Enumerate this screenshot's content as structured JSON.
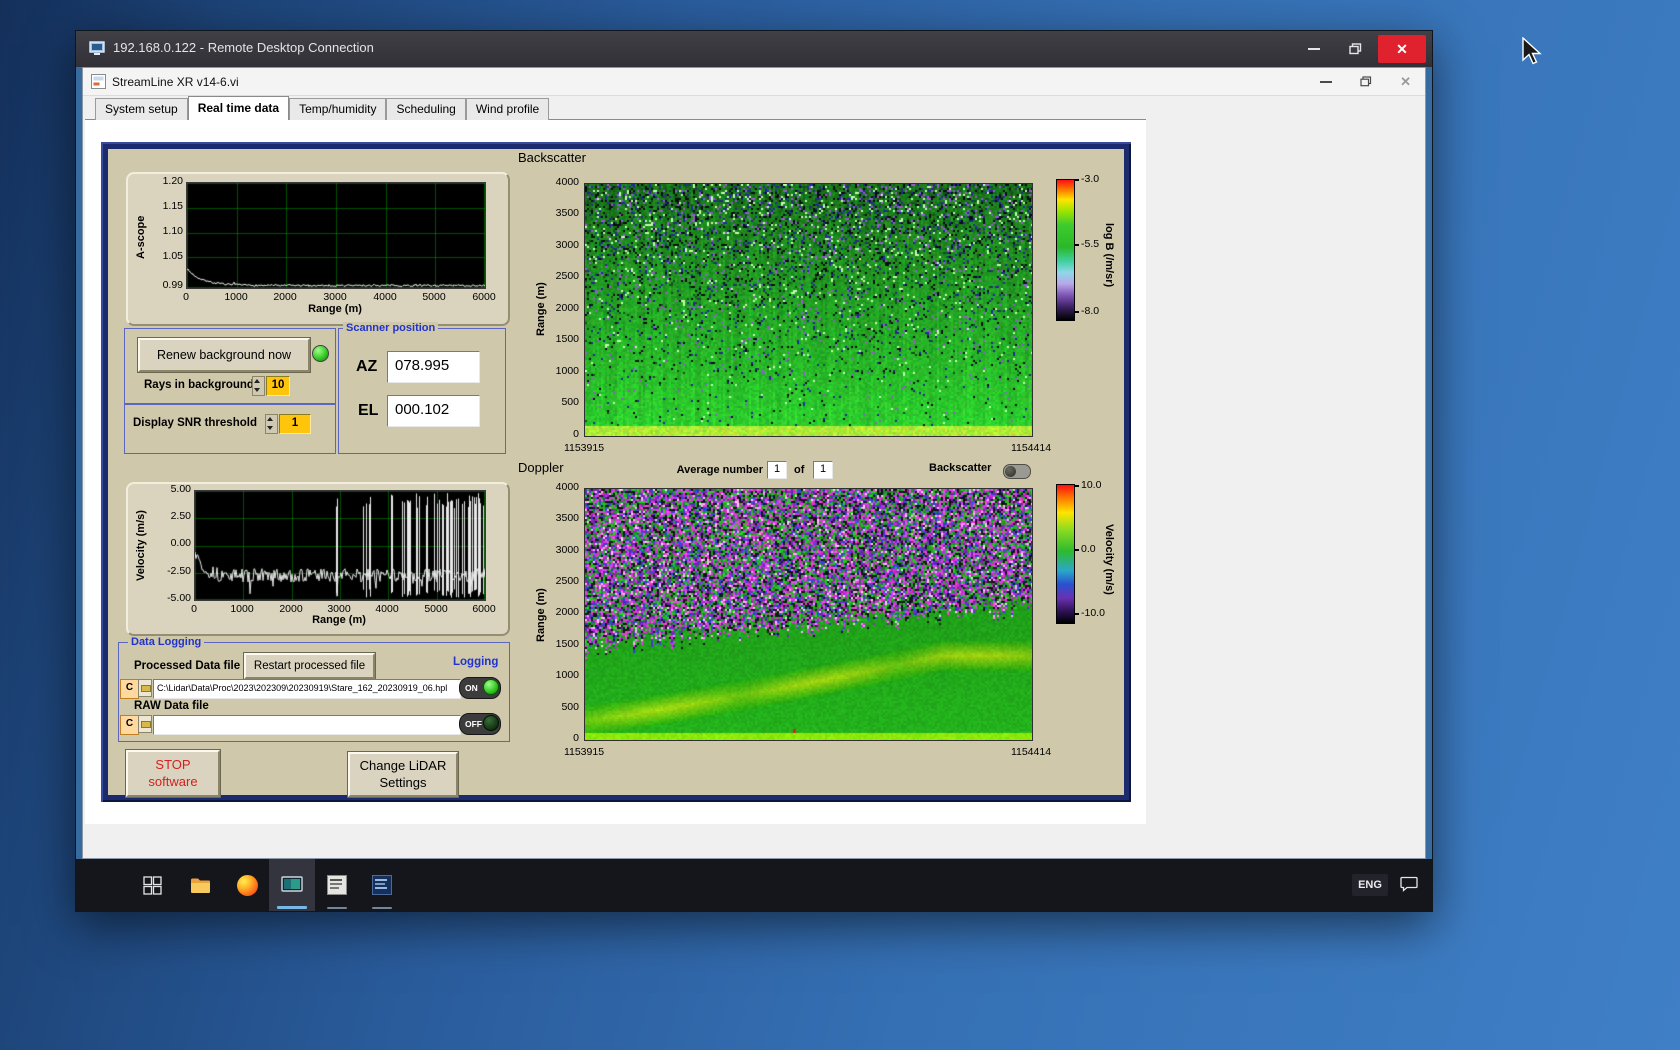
{
  "colors": {
    "panel_navy": "#1c2a6e",
    "panel_tan": "#cfc8ab",
    "field_orange": "#ffc40c",
    "led_green": "#2fc41e",
    "close_red": "#e0222e",
    "group_title_blue": "#2233cc"
  },
  "rdp": {
    "title": "192.168.0.122 - Remote Desktop Connection"
  },
  "app": {
    "title": "StreamLine XR v14-6.vi",
    "tabs": [
      "System setup",
      "Real time data",
      "Temp/humidity",
      "Scheduling",
      "Wind profile"
    ],
    "active_tab": "Real time data"
  },
  "ascope": {
    "ylabel": "A-scope",
    "xlabel": "Range (m)",
    "yticks": [
      "1.20",
      "1.15",
      "1.10",
      "1.05",
      "0.99"
    ],
    "xticks": [
      "0",
      "1000",
      "2000",
      "3000",
      "4000",
      "5000",
      "6000"
    ]
  },
  "background_ctrl": {
    "renew_button": "Renew background now",
    "rays_label": "Rays in background",
    "rays_value": "10",
    "snr_label": "Display SNR threshold",
    "snr_value": "1"
  },
  "scanner": {
    "title": "Scanner position",
    "az_label": "AZ",
    "az_value": "078.995",
    "el_label": "EL",
    "el_value": "000.102"
  },
  "backscatter": {
    "title": "Backscatter",
    "ylabel": "Range (m)",
    "yticks": [
      "4000",
      "3500",
      "3000",
      "2500",
      "2000",
      "1500",
      "1000",
      "500",
      "0"
    ],
    "x_start": "1153915",
    "x_end": "1154414",
    "cbar_label": "log B (/m/sr)",
    "cbar_ticks": [
      "-3.0",
      "-5.5",
      "-8.0"
    ]
  },
  "doppler": {
    "title": "Doppler",
    "avg_label": "Average number",
    "avg_value": "1",
    "of_label": "of",
    "of_count": "1",
    "toggle_label": "Backscatter",
    "ylabel": "Range (m)",
    "yticks": [
      "4000",
      "3500",
      "3000",
      "2500",
      "2000",
      "1500",
      "1000",
      "500",
      "0"
    ],
    "x_start": "1153915",
    "x_end": "1154414",
    "cbar_label": "Velocity (m/s)",
    "cbar_ticks": [
      "10.0",
      "0.0",
      "-10.0"
    ]
  },
  "velocity": {
    "ylabel": "Velocity (m/s)",
    "xlabel": "Range (m)",
    "yticks": [
      "5.00",
      "2.50",
      "0.00",
      "-2.50",
      "-5.00"
    ],
    "xticks": [
      "0",
      "1000",
      "2000",
      "3000",
      "4000",
      "5000",
      "6000"
    ]
  },
  "logging": {
    "title": "Data Logging",
    "processed_label": "Processed Data file",
    "restart_button": "Restart processed file",
    "logging_label": "Logging",
    "drive_letter": "C",
    "processed_path": "C:\\Lidar\\Data\\Proc\\2023\\202309\\20230919\\Stare_162_20230919_06.hpl",
    "processed_state": "ON",
    "raw_label": "RAW Data file",
    "raw_path": "",
    "raw_state": "OFF"
  },
  "actions": {
    "stop_button": "STOP\nsoftware",
    "settings_button": "Change LiDAR\nSettings"
  },
  "taskbar": {
    "language": "ENG"
  }
}
